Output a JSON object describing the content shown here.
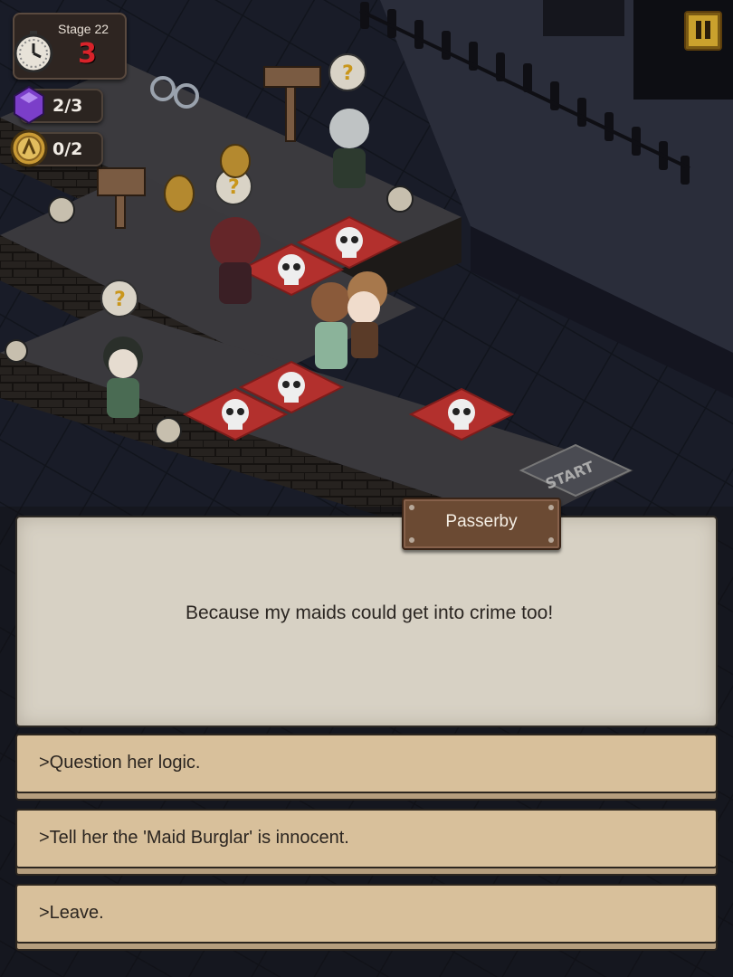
{
  "hud": {
    "stage_label": "Stage 22",
    "stage_count": "3",
    "gems": "2/3",
    "coins": "0/2"
  },
  "board": {
    "start_label": "START"
  },
  "icons": {
    "clock": "stopwatch-icon",
    "gem": "purple-gem-icon",
    "coin": "gold-coin-icon",
    "pause": "pause-icon",
    "skull": "skull-tile-icon",
    "question": "question-bubble-icon"
  },
  "colors": {
    "danger_tile": "#b3302d",
    "stage_count": "#d8232a",
    "pause_button": "#caa12d",
    "dialog_bg": "#d7d1c4",
    "choice_bg": "#d8c09b"
  },
  "dialog": {
    "speaker": "Passerby",
    "text": "Because my maids could get into crime too!"
  },
  "choices": [
    {
      "label": ">Question her logic."
    },
    {
      "label": ">Tell her the 'Maid Burglar' is innocent."
    },
    {
      "label": ">Leave."
    }
  ]
}
